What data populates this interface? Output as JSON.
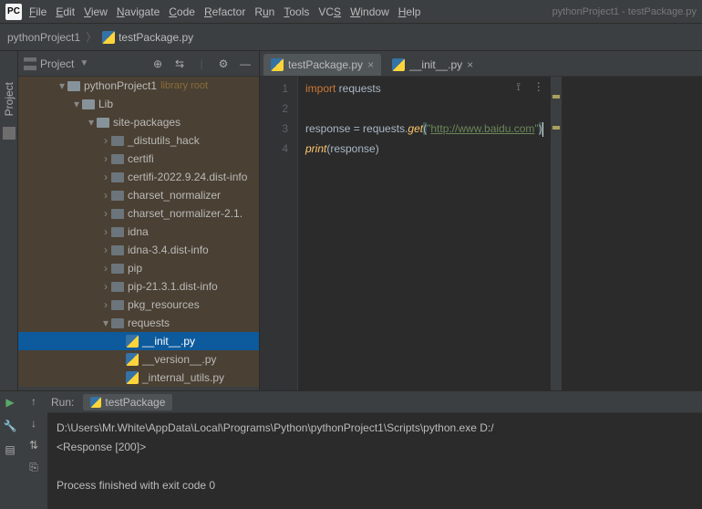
{
  "window_title": "pythonProject1 - testPackage.py",
  "menu": [
    "File",
    "Edit",
    "View",
    "Navigate",
    "Code",
    "Refactor",
    "Run",
    "Tools",
    "VCS",
    "Window",
    "Help"
  ],
  "breadcrumb": {
    "root": "pythonProject1",
    "file": "testPackage.py"
  },
  "project_header": {
    "label": "Project"
  },
  "tree_root": {
    "name": "pythonProject1",
    "hint": "library root"
  },
  "lib": "Lib",
  "sp": "site-packages",
  "libitems": [
    "_distutils_hack",
    "certifi",
    "certifi-2022.9.24.dist-info",
    "charset_normalizer",
    "charset_normalizer-2.1.",
    "idna",
    "idna-3.4.dist-info",
    "pip",
    "pip-21.3.1.dist-info",
    "pkg_resources"
  ],
  "requests_label": "requests",
  "req_files": [
    "__init__.py",
    "__version__.py",
    "_internal_utils.py"
  ],
  "tabs": [
    {
      "label": "testPackage.py",
      "active": true
    },
    {
      "label": "__init__.py",
      "active": false
    }
  ],
  "code": {
    "l1_kw": "import",
    "l1_rest": " requests",
    "l3_a": "response = requests.",
    "l3_fn": "get",
    "l3_p1": "(",
    "l3_q1": "\"",
    "l3_url": "http://www.baidu.com",
    "l3_q2": "\"",
    "l3_p2": ")",
    "l4_fn": "print",
    "l4_rest": "(response)"
  },
  "run": {
    "label": "Run:",
    "config": "testPackage",
    "out1": "D:\\Users\\Mr.White\\AppData\\Local\\Programs\\Python\\pythonProject1\\Scripts\\python.exe D:/",
    "out2": "<Response [200]>",
    "out3": "",
    "out4": "Process finished with exit code 0"
  }
}
